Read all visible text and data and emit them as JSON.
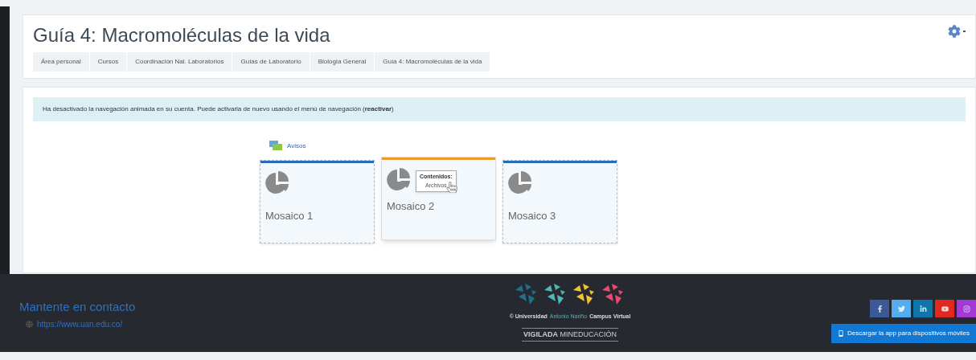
{
  "page_title": "Guía 4: Macromoléculas de la vida",
  "breadcrumbs": [
    "Área personal",
    "Cursos",
    "Coordinación Nal. Laboratorios",
    "Guías de Laboratorio",
    "Biología General",
    "Guía 4: Macromoléculas de la vida"
  ],
  "alert": "Ha desactivado la navegación animada en su cuenta. Puede activarla de nuevo usando el menú de navegación (**reactivar**)",
  "forum_link": "Avisos",
  "tiles": [
    {
      "title": "Mosaico 1",
      "color": "#2a6bb8",
      "hovered": false
    },
    {
      "title": "Mosaico 2",
      "color": "#e99b2b",
      "hovered": true,
      "tooltip": {
        "title": "Contenidos:",
        "text": "Archivos"
      }
    },
    {
      "title": "Mosaico 3",
      "color": "#2a6bb8",
      "hovered": false
    }
  ],
  "footer": {
    "heading": "Mantente en contacto",
    "url": "https://www.uan.edu.co/",
    "copyright": [
      {
        "text": "© Universidad",
        "highlight": false
      },
      {
        "text": "Antonio Nariño",
        "highlight": true
      },
      {
        "text": "Campus Virtual",
        "highlight": false
      }
    ],
    "vigilada": "**VIGILADA** MINEDUCACIÓN",
    "social": [
      {
        "kind": "facebook",
        "color": "#3b5998"
      },
      {
        "kind": "twitter",
        "color": "#55acee"
      },
      {
        "kind": "linkedin",
        "color": "#0e76a8"
      },
      {
        "kind": "youtube",
        "color": "#e02a20"
      },
      {
        "kind": "instagram",
        "color": "#a43ad6"
      }
    ],
    "app_button": "Descargar la app para dispositivos móviles"
  }
}
